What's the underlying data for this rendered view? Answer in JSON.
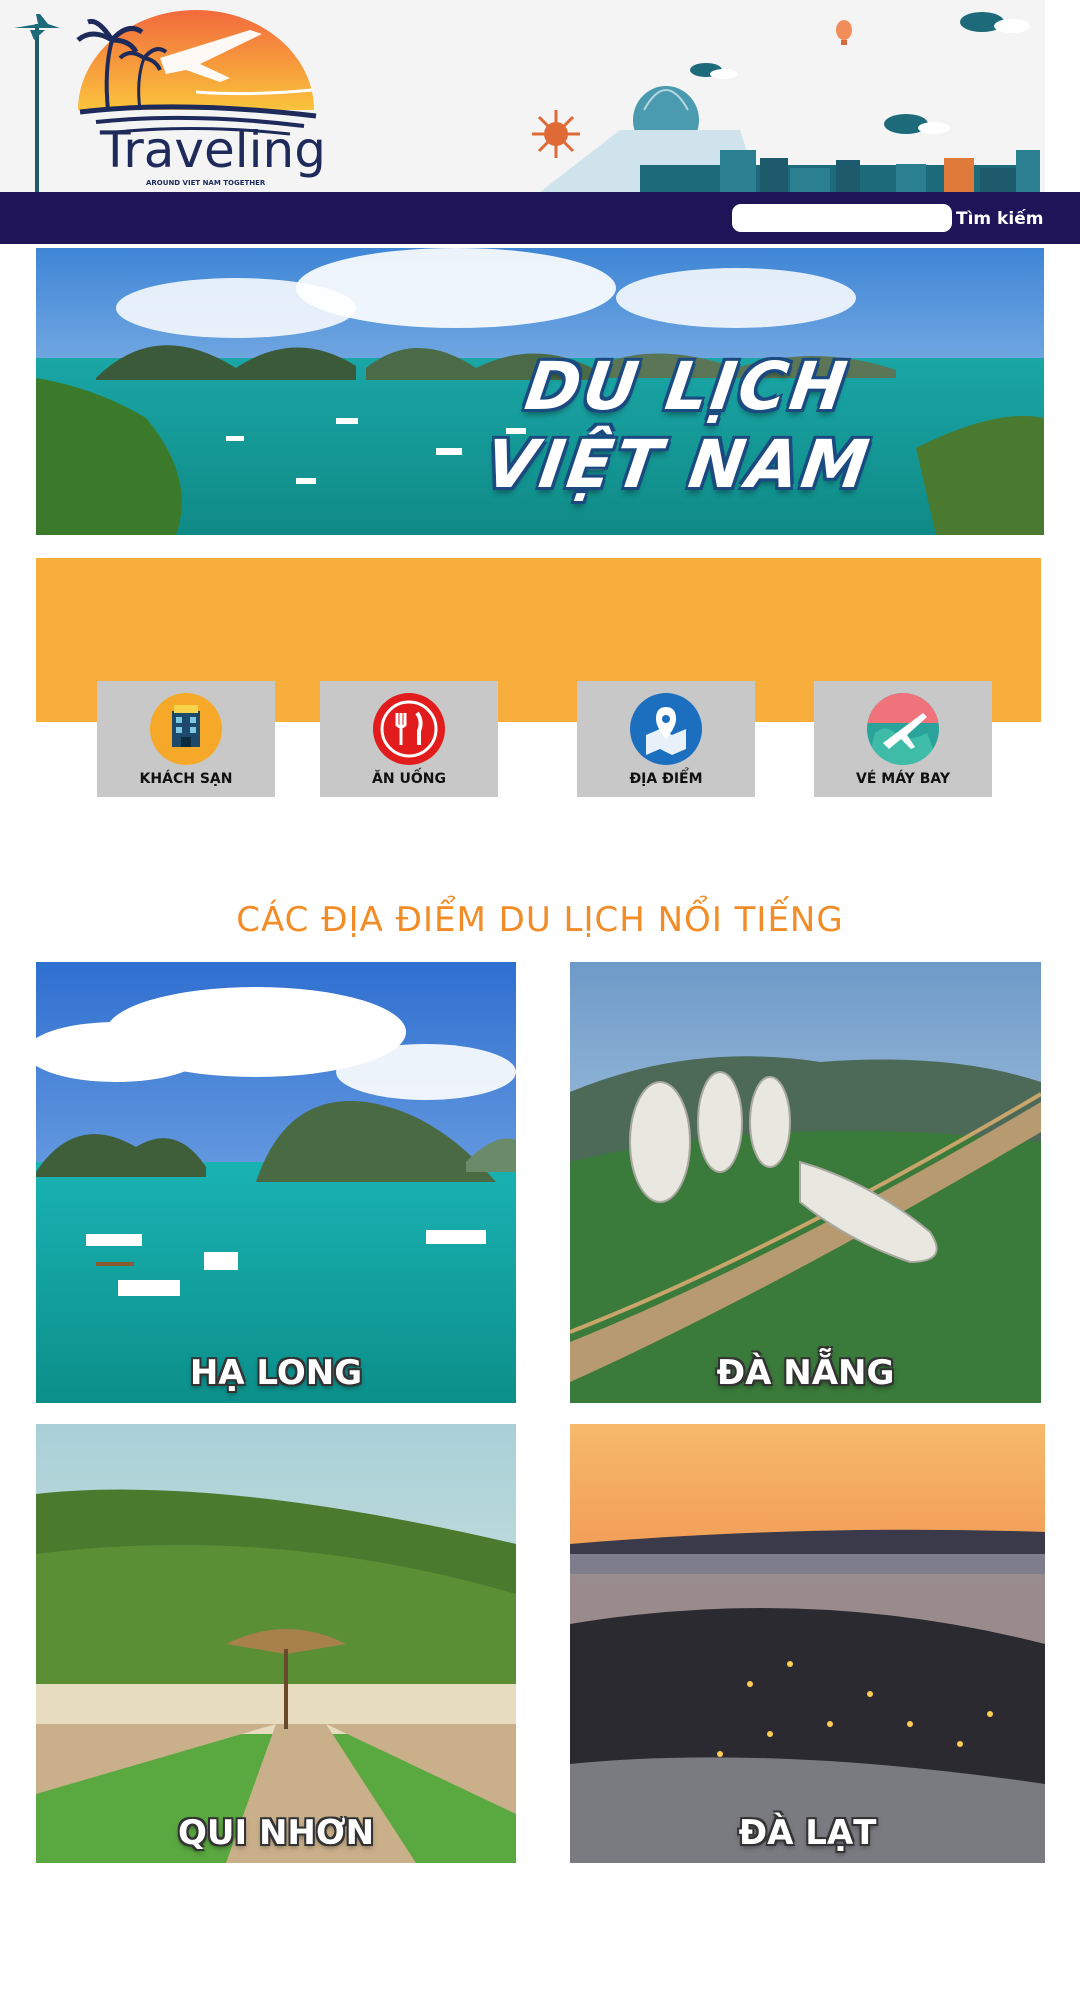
{
  "header": {
    "logo_text": "Traveling",
    "logo_tagline": "AROUND VIET NAM TOGETHER"
  },
  "search": {
    "placeholder": "",
    "value": "",
    "button_label": "Tìm kiếm"
  },
  "banner": {
    "line1": "DU LỊCH",
    "line2": "VIỆT NAM"
  },
  "categories": [
    {
      "label": "KHÁCH SẠN",
      "icon": "hotel-icon",
      "color": "#f6a928"
    },
    {
      "label": "ĂN UỐNG",
      "icon": "fork-knife-icon",
      "color": "#e21c1c"
    },
    {
      "label": "ĐỊA ĐIỂM",
      "icon": "map-pin-icon",
      "color": "#1c6fbf"
    },
    {
      "label": "VÉ MÁY BAY",
      "icon": "airplane-globe-icon",
      "color": "#2aa39a"
    }
  ],
  "destinations": {
    "title": "CÁC ĐỊA ĐIỂM DU LỊCH NỔI TIẾNG",
    "items": [
      {
        "name": "HẠ LONG"
      },
      {
        "name": "ĐÀ NẴNG"
      },
      {
        "name": "QUI NHƠN"
      },
      {
        "name": "ĐÀ LẠT"
      }
    ]
  },
  "colors": {
    "nav": "#1f1458",
    "accent_orange": "#f8ae3c",
    "title_orange": "#f28c26",
    "card_gray": "#c8c8c8"
  }
}
